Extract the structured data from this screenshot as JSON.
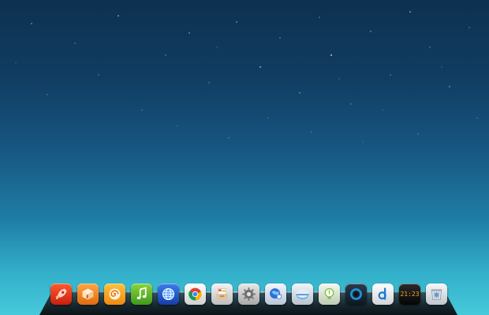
{
  "desktop": {
    "wallpaper": "starry-night-gradient"
  },
  "dock": {
    "items": [
      {
        "icon": "rocket-icon",
        "color": "#e8341c"
      },
      {
        "icon": "box-icon",
        "color": "#f5841f"
      },
      {
        "icon": "spiral-icon",
        "color": "#f5a21f"
      },
      {
        "icon": "music-note-icon",
        "color": "#5ab82e"
      },
      {
        "icon": "globe-icon",
        "color": "#1d56c9"
      },
      {
        "icon": "chrome-icon",
        "color": "#e8e8e8"
      },
      {
        "icon": "file-drawer-icon",
        "color": "#d9d9d9"
      },
      {
        "icon": "gear-icon",
        "color": "#cfcfcf"
      },
      {
        "icon": "globe-shield-icon",
        "color": "#d6e0ef"
      },
      {
        "icon": "disk-icon",
        "color": "#d8dfe6"
      },
      {
        "icon": "bulb-icon",
        "color": "#e1eadb"
      },
      {
        "icon": "ring-icon",
        "color": "#1c2a3a"
      },
      {
        "icon": "d-logo-icon",
        "color": "#ffffff"
      },
      {
        "icon": "digital-clock-icon",
        "color": "#111111",
        "time": "21:23"
      },
      {
        "icon": "trash-icon",
        "color": "#e4e8ec"
      }
    ]
  }
}
